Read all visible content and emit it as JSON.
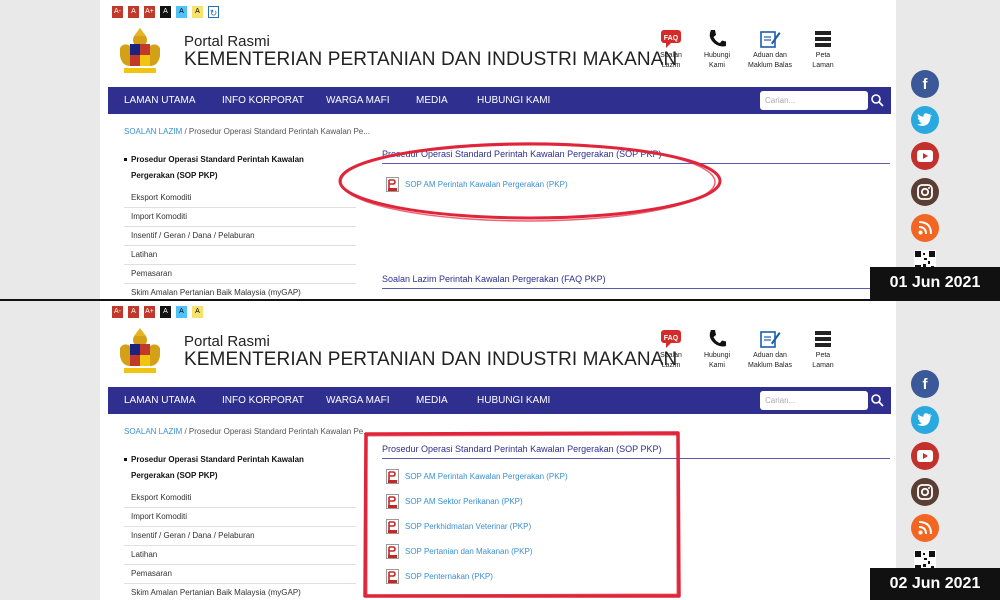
{
  "site": {
    "access_buttons": [
      "A-",
      "A",
      "A+",
      "A",
      "A",
      "A",
      "↻"
    ],
    "portal_label": "Portal Rasmi",
    "ministry_name": "KEMENTERIAN PERTANIAN DAN INDUSTRI MAKANAN",
    "header_icons": [
      {
        "icon": "faq-icon",
        "label1": "Soalan",
        "label2": "Lazim"
      },
      {
        "icon": "phone-icon",
        "label1": "Hubungi",
        "label2": "Kami"
      },
      {
        "icon": "feedback-icon",
        "label1": "Aduan dan",
        "label2": "Maklum Balas"
      },
      {
        "icon": "sitemap-icon",
        "label1": "Peta",
        "label2": "Laman"
      }
    ],
    "nav": [
      "LAMAN UTAMA",
      "INFO KORPORAT",
      "WARGA MAFI",
      "MEDIA",
      "HUBUNGI KAMI"
    ],
    "search_placeholder": "Carian...",
    "breadcrumb_link": "SOALAN LAZIM",
    "breadcrumb_rest": " / Prosedur Operasi Standard Perintah Kawalan Pe...",
    "sidebar_active_line1": "Prosedur Operasi Standard Perintah Kawalan",
    "sidebar_active_line2": "Pergerakan (SOP PKP)",
    "sidebar": [
      "Eksport Komoditi",
      "Import Komoditi",
      "Insentif / Geran / Dana / Pelaburan",
      "Latihan",
      "Pemasaran",
      "Skim Amalan Pertanian Baik Malaysia (myGAP)"
    ],
    "content_title": "Prosedur Operasi Standard Perintah Kawalan Pergerakan (SOP PKP)",
    "faq_title": "Soalan Lazim Perintah Kawalan Pergerakan (FAQ PKP)"
  },
  "social": [
    "facebook-icon",
    "twitter-icon",
    "youtube-icon",
    "instagram-icon",
    "rss-icon",
    "qr-code-icon"
  ],
  "colors": {
    "nav": "#2e2f8f",
    "link": "#3a8fd0",
    "annotation": "#e0253a",
    "badge": "#111111"
  },
  "frame_top": {
    "date": "01 Jun 2021",
    "documents": [
      "SOP AM Perintah Kawalan Pergerakan (PKP)"
    ]
  },
  "frame_bottom": {
    "date": "02 Jun 2021",
    "documents": [
      "SOP AM Perintah Kawalan Pergerakan (PKP)",
      "SOP AM Sektor Perikanan (PKP)",
      "SOP Perkhidmatan Veterinar (PKP)",
      "SOP Pertanian dan Makanan (PKP)",
      "SOP Penternakan (PKP)"
    ]
  }
}
